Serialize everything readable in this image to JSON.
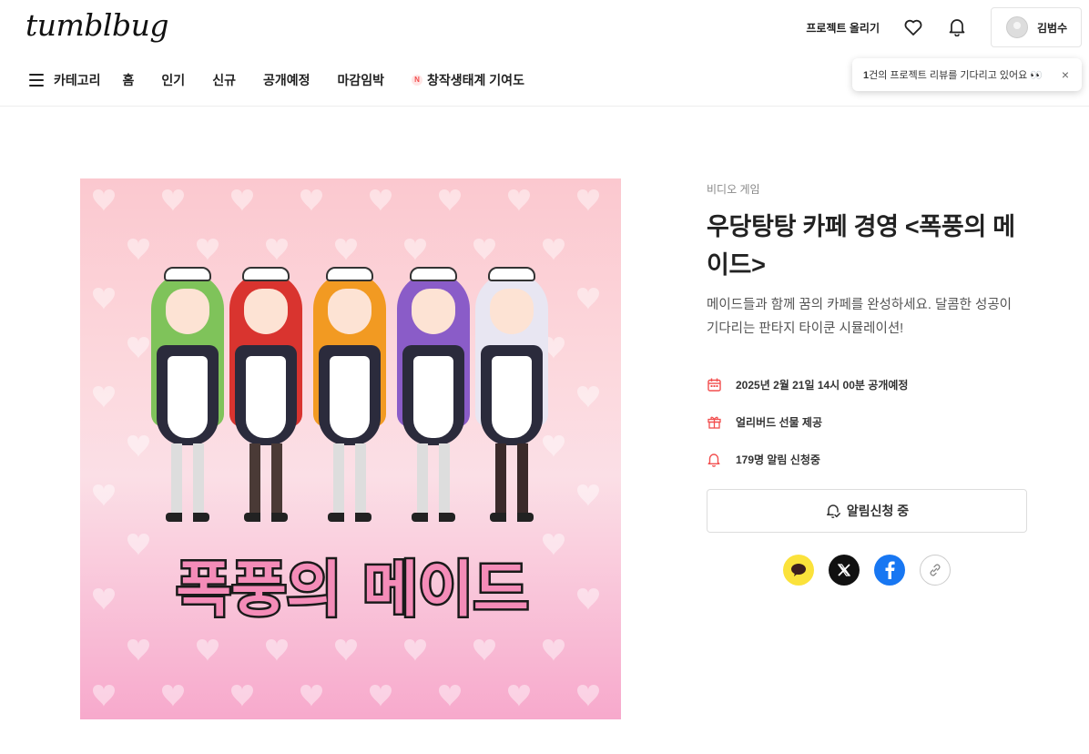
{
  "header": {
    "logo": "tumblbug",
    "upload_project": "프로젝트 올리기",
    "user_name": "김범수"
  },
  "nav": {
    "category": "카테고리",
    "items": [
      "홈",
      "인기",
      "신규",
      "공개예정",
      "마감임박"
    ],
    "ecosystem": "창작생태계 기여도",
    "ecosystem_badge": "N"
  },
  "tooltip": {
    "count": "1",
    "text": "건의 프로젝트 리뷰를 기다리고 있어요 👀",
    "close": "×"
  },
  "project": {
    "category": "비디오 게임",
    "title": "우당탕탕 카페 경영 <폭풍의 메이드>",
    "description": "메이드들과 함께 꿈의 카페를 완성하세요. 달콤한 성공이 기다리는 판타지 타이쿤 시뮬레이션!",
    "launch_date": "2025년 2월 21일 14시 00분 공개예정",
    "early_bird": "얼리버드 선물 제공",
    "notify_count": "179명 알림 신청중",
    "notify_button": "알림신청 중",
    "image_logo_text": "폭풍의 메이드"
  },
  "share": {
    "icons": [
      "kakao-icon",
      "x-icon",
      "facebook-icon",
      "link-icon"
    ]
  },
  "colors": {
    "accent": "#f24e4e",
    "kakao": "#fbe23b",
    "facebook": "#1877f2"
  }
}
